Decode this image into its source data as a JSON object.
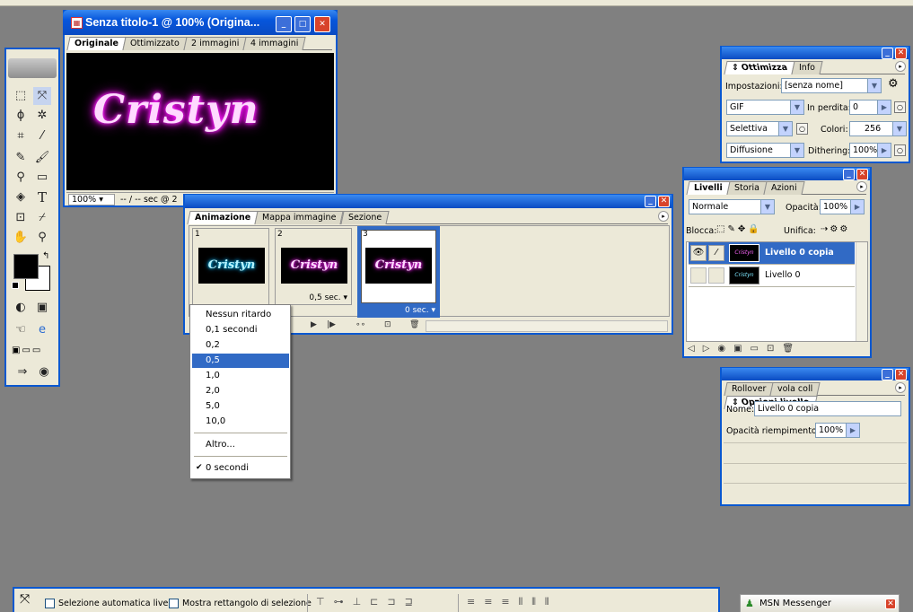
{
  "doc_window": {
    "title": "Senza titolo-1 @ 100% (Origina...",
    "tabs": [
      "Originale",
      "Ottimizzato",
      "2 immagini",
      "4 immagini"
    ],
    "canvas_text": "Cristyn",
    "zoom": "100%",
    "status": "-- / -- sec @ 2"
  },
  "animation_panel": {
    "tabs": [
      "Animazione",
      "Mappa immagine",
      "Sezione"
    ],
    "frames": [
      {
        "num": "1",
        "text": "Cristyn",
        "delay": "",
        "color": "#7ee7ff"
      },
      {
        "num": "2",
        "text": "Cristyn",
        "delay": "0,5 sec.",
        "color": "#ff66ff"
      },
      {
        "num": "3",
        "text": "Cristyn",
        "delay": "0 sec.",
        "color": "#ff66ff"
      }
    ]
  },
  "delay_menu": {
    "items": [
      "Nessun ritardo",
      "0,1 secondi",
      "0,2",
      "0,5",
      "1,0",
      "2,0",
      "5,0",
      "10,0"
    ],
    "selected_index": 3,
    "other": "Altro...",
    "checked": "0 secondi"
  },
  "optimize_panel": {
    "tabs": [
      "Ottimizza",
      "Info"
    ],
    "settings_label": "Impostazioni:",
    "settings_value": "[senza nome]",
    "format": "GIF",
    "lossy_label": "In perdita:",
    "lossy_value": "0",
    "palette": "Selettiva",
    "colors_label": "Colori:",
    "colors_value": "256",
    "dither_type": "Diffusione",
    "dither_label": "Dithering:",
    "dither_value": "100%"
  },
  "layers_panel": {
    "tabs": [
      "Livelli",
      "Storia",
      "Azioni"
    ],
    "blend_mode": "Normale",
    "opacity_label": "Opacità:",
    "opacity_value": "100%",
    "lock_label": "Blocca:",
    "unify_label": "Unifica:",
    "layers": [
      {
        "name": "Livello 0 copia",
        "selected": true
      },
      {
        "name": "Livello 0",
        "selected": false
      }
    ]
  },
  "layer_options_panel": {
    "tabs": [
      "Rollover",
      "vola coll",
      "Opzioni livello"
    ],
    "name_label": "Nome:",
    "name_value": "Livello 0 copia",
    "fill_label": "Opacità riempimento:",
    "fill_value": "100%"
  },
  "options_bar": {
    "auto_select": "Selezione automatica livello",
    "show_bbox": "Mostra rettangolo di selezione"
  },
  "taskbar": {
    "msn": "MSN Messenger"
  },
  "colors": {
    "xp_blue": "#0a58d0",
    "panel_bg": "#ece9d8",
    "selection": "#316ac5",
    "glow_pink": "#ff66ff"
  }
}
